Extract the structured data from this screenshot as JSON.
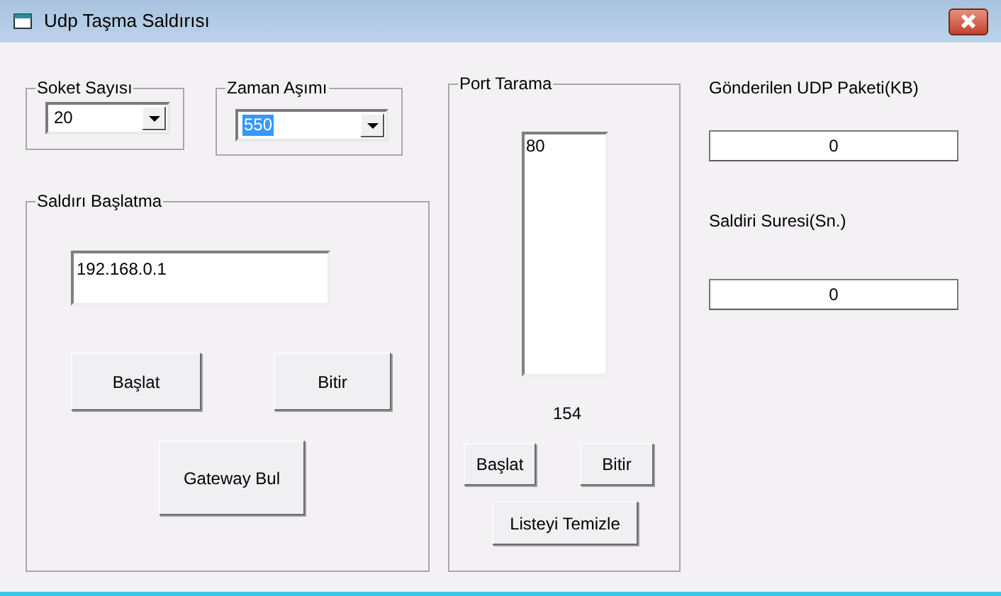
{
  "window": {
    "title": "Udp Taşma Saldırısı"
  },
  "socket_count": {
    "label": "Soket Sayısı",
    "value": "20",
    "text_selected": false
  },
  "timeout": {
    "label": "Zaman Aşımı",
    "value": "550",
    "text_selected": true
  },
  "attack": {
    "label": "Saldırı Başlatma",
    "ip_value": "192.168.0.1",
    "buttons": [
      "Başlat",
      "Bitir",
      "Gateway Bul"
    ]
  },
  "port_scan": {
    "label": "Port Tarama",
    "ports": [
      "80"
    ],
    "current_port": "154",
    "buttons": [
      "Başlat",
      "Bitir",
      "Listeyi Temizle"
    ]
  },
  "sent_packets": {
    "label": "Gönderilen UDP Paketi(KB)",
    "value": "0"
  },
  "attack_duration": {
    "label": "Saldiri Suresi(Sn.)",
    "value": "0"
  }
}
